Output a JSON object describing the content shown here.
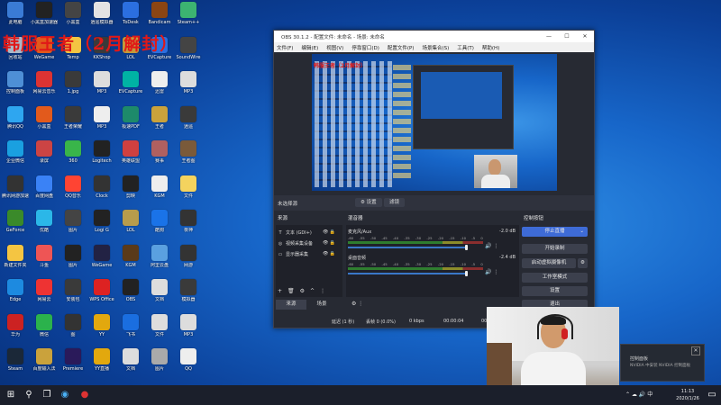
{
  "banner": "韩服王者（2月解封）",
  "desktop_icons": [
    {
      "label": "此电脑",
      "color": "#3a7bd5"
    },
    {
      "label": "小黑盒加速器",
      "color": "#222"
    },
    {
      "label": "小黑盒",
      "color": "#444"
    },
    {
      "label": "逍遥模拟器",
      "color": "#e3e3e3"
    },
    {
      "label": "ToDesk",
      "color": "#2b6fe0"
    },
    {
      "label": "Bandicam",
      "color": "#8b4513"
    },
    {
      "label": "Steam++",
      "color": "#3cb371"
    },
    {
      "label": "回收站",
      "color": "#aab8c8"
    },
    {
      "label": "WeGame",
      "color": "#e25a1c"
    },
    {
      "label": "Temp",
      "color": "#f4c542"
    },
    {
      "label": "KKShop",
      "color": "#3a3a3a"
    },
    {
      "label": "LOL",
      "color": "#c49a3a"
    },
    {
      "label": "EVCapture",
      "color": "#2b6fe0"
    },
    {
      "label": "SoundWire",
      "color": "#444"
    },
    {
      "label": "控制面板",
      "color": "#4e8fd6"
    },
    {
      "label": "网易云音乐",
      "color": "#d33"
    },
    {
      "label": "1.jpg",
      "color": "#3a3a3a"
    },
    {
      "label": "MP3",
      "color": "#ddd"
    },
    {
      "label": "EVCapture",
      "color": "#00b3a4"
    },
    {
      "label": "迅雷",
      "color": "#eee"
    },
    {
      "label": "MP3",
      "color": "#ddd"
    },
    {
      "label": "腾讯QQ",
      "color": "#2ea6f0"
    },
    {
      "label": "小黑盒",
      "color": "#e25a1c"
    },
    {
      "label": "王者荣耀",
      "color": "#3a3a3a"
    },
    {
      "label": "MP3",
      "color": "#eee"
    },
    {
      "label": "极速PDF",
      "color": "#1d8a6a"
    },
    {
      "label": "王者",
      "color": "#caa23c"
    },
    {
      "label": "逍遥",
      "color": "#3a3a3a"
    },
    {
      "label": "企业微信",
      "color": "#1aa0e0"
    },
    {
      "label": "录屏",
      "color": "#c44"
    },
    {
      "label": "360",
      "color": "#39b54a"
    },
    {
      "label": "Logitech",
      "color": "#222"
    },
    {
      "label": "英雄联盟",
      "color": "#d04040"
    },
    {
      "label": "赛事",
      "color": "#b06060"
    },
    {
      "label": "王者图",
      "color": "#7a5a3a"
    },
    {
      "label": "腾讯网游加速器",
      "color": "#333"
    },
    {
      "label": "百度网盘",
      "color": "#3a82f6"
    },
    {
      "label": "QQ音乐",
      "color": "#f43"
    },
    {
      "label": "Clock",
      "color": "#333"
    },
    {
      "label": "剪映",
      "color": "#222"
    },
    {
      "label": "KGM",
      "color": "#eee"
    },
    {
      "label": "文件",
      "color": "#f4d35e"
    },
    {
      "label": "GeForce",
      "color": "#3a8a2a"
    },
    {
      "label": "优酷",
      "color": "#2bb7e8"
    },
    {
      "label": "图片",
      "color": "#444"
    },
    {
      "label": "Logi G",
      "color": "#222"
    },
    {
      "label": "LOL",
      "color": "#b89c4c"
    },
    {
      "label": "酷狗",
      "color": "#1a73e8"
    },
    {
      "label": "夜神",
      "color": "#333"
    },
    {
      "label": "新建文件夹",
      "color": "#f4c542"
    },
    {
      "label": "斗鱼",
      "color": "#e55"
    },
    {
      "label": "图片",
      "color": "#222"
    },
    {
      "label": "WeGame",
      "color": "#224"
    },
    {
      "label": "KGM",
      "color": "#5a3a1a"
    },
    {
      "label": "阿里云盘",
      "color": "#5aa0e0"
    },
    {
      "label": "网游",
      "color": "#333"
    },
    {
      "label": "Edge",
      "color": "#1d8ae0"
    },
    {
      "label": "网易云",
      "color": "#e33"
    },
    {
      "label": "安装包",
      "color": "#3a3a3a"
    },
    {
      "label": "WPS Office",
      "color": "#d22"
    },
    {
      "label": "OBS",
      "color": "#222"
    },
    {
      "label": "文档",
      "color": "#ddd"
    },
    {
      "label": "模拟器",
      "color": "#3a3a3a"
    },
    {
      "label": "华为",
      "color": "#c22"
    },
    {
      "label": "微信",
      "color": "#2bb24c"
    },
    {
      "label": "图",
      "color": "#333"
    },
    {
      "label": "YY",
      "color": "#e2a80e"
    },
    {
      "label": "飞书",
      "color": "#1a6ee0"
    },
    {
      "label": "文件",
      "color": "#ddd"
    },
    {
      "label": "MP3",
      "color": "#ddd"
    },
    {
      "label": "Steam",
      "color": "#1b2838"
    },
    {
      "label": "百度输入法",
      "color": "#caa23c"
    },
    {
      "label": "Premiere",
      "color": "#2a1a5a"
    },
    {
      "label": "YY直播",
      "color": "#e2a80e"
    },
    {
      "label": "文档",
      "color": "#ddd"
    },
    {
      "label": "图片",
      "color": "#aaa"
    },
    {
      "label": "QQ",
      "color": "#eee"
    }
  ],
  "obs": {
    "title": "OBS 30.1.2 - 配置文件: 未命名 - 场景: 未命名",
    "menu": [
      "文件(F)",
      "编辑(E)",
      "视图(V)",
      "停靠窗口(D)",
      "配置文件(P)",
      "场景集合(S)",
      "工具(T)",
      "帮助(H)"
    ],
    "preview_banner": "韩服王者（2月解封）",
    "source_label": "未选择源",
    "props_btn": "⚙ 设置",
    "filters_btn": "滤镜",
    "sources_header": "来源",
    "sources": [
      {
        "icon": "T",
        "name": "文本 (GDI+)"
      },
      {
        "icon": "◎",
        "name": "视频采集设备"
      },
      {
        "icon": "▭",
        "name": "显示器采集"
      }
    ],
    "mixer_header": "混音器",
    "mixer": [
      {
        "name": "麦克风/Aux",
        "db": "-2.0 dB"
      },
      {
        "name": "桌面音频",
        "db": "-2.4 dB"
      }
    ],
    "ticks": [
      "-60",
      "-55",
      "-50",
      "-45",
      "-40",
      "-35",
      "-30",
      "-25",
      "-20",
      "-15",
      "-10",
      "-5",
      "0"
    ],
    "controls_header": "控制按钮",
    "controls": [
      "停止直播",
      "开始录制",
      "启动虚拟摄像机",
      "工作室模式",
      "设置",
      "退出"
    ],
    "tabs": [
      "来源",
      "场景"
    ],
    "status": {
      "delay": "延迟 (1 秒)",
      "dropped": "丢帧 0 (0.0%)",
      "kbps": "0 kbps",
      "time": "00:00:04",
      "rec": "00:00:00",
      "cpu": "CPU: 2.1%, 60.00 / 60.00 FPS"
    }
  },
  "notification": {
    "title": "控制面板",
    "body": "NVIDIA 中安装 NVIDIA 控制面板"
  },
  "taskbar": {
    "time": "11:13",
    "date": "2020/1/26"
  }
}
